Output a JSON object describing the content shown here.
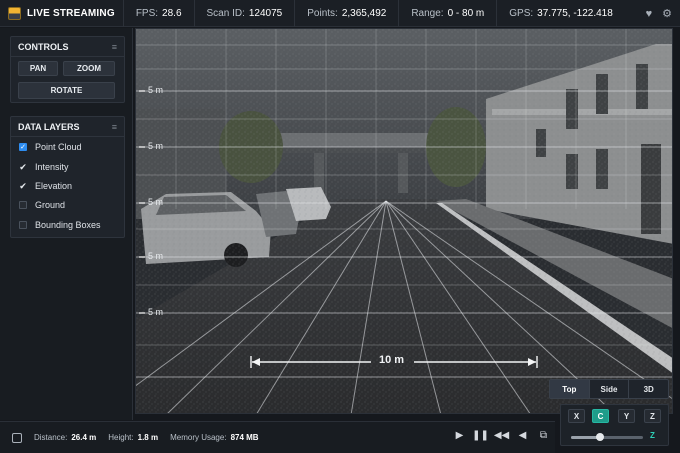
{
  "topbar": {
    "title": "LIVE STREAMING",
    "stats": [
      {
        "key": "FPS:",
        "value": "28.6"
      },
      {
        "key": "Scan ID:",
        "value": "124075"
      },
      {
        "key": "Points:",
        "value": "2,365,492"
      },
      {
        "key": "Range:",
        "value": "0 - 80 m"
      },
      {
        "key": "GPS:",
        "value": "37.775, -122.418"
      }
    ],
    "icons": [
      "heart-icon",
      "gear-icon"
    ]
  },
  "controls": {
    "title": "CONTROLS",
    "pan_label": "PAN",
    "zoom_label": "ZOOM",
    "rotate_label": "ROTATE"
  },
  "data_layers": {
    "title": "DATA LAYERS",
    "items": [
      {
        "label": "Point Cloud",
        "checked": true
      },
      {
        "label": "Intensity",
        "checked": true
      },
      {
        "label": "Elevation",
        "checked": true
      },
      {
        "label": "Ground",
        "checked": false
      },
      {
        "label": "Bounding Boxes",
        "checked": false
      }
    ]
  },
  "viewport": {
    "distance_markers": [
      "5 m",
      "5 m",
      "5 m",
      "5 m",
      "5 m"
    ],
    "scale_label": "10 m"
  },
  "view_modes": {
    "items": [
      "Top",
      "Side",
      "3D"
    ],
    "active": "Top"
  },
  "axis_panel": {
    "buttons": [
      "X",
      "C",
      "Y",
      "Z"
    ],
    "active": "C",
    "slider_label": "Z",
    "slider_value": 0.4
  },
  "status": {
    "distance_key": "Distance:",
    "distance_value": "26.4 m",
    "height_key": "Height:",
    "height_value": "1.8 m",
    "memory_key": "Memory Usage:",
    "memory_value": "874 MB"
  },
  "colors": {
    "accent": "#1f9c8a",
    "checkbox": "#2d8cf0",
    "brand": "#f2b432"
  }
}
